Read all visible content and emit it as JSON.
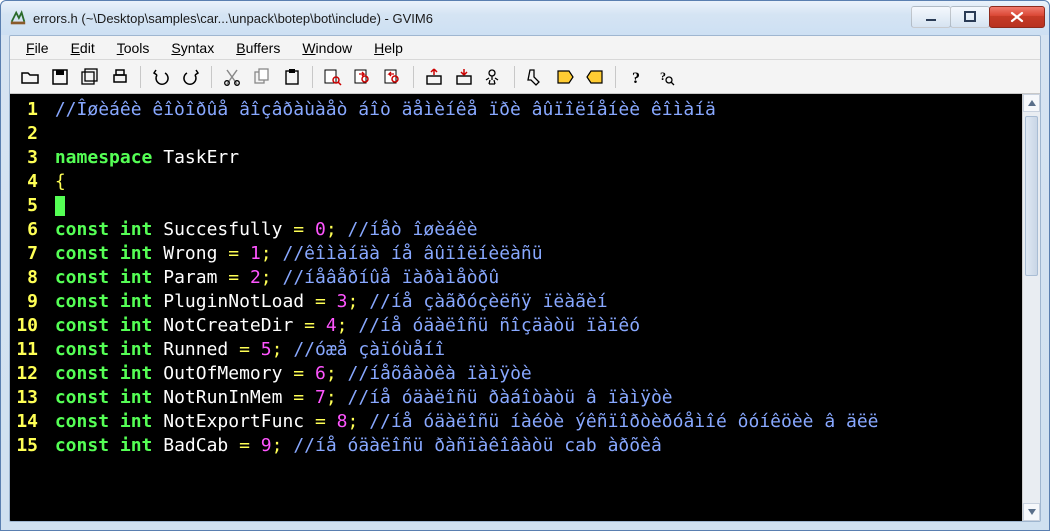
{
  "title": "errors.h (~\\Desktop\\samples\\car...\\unpack\\botep\\bot\\include) - GVIM6",
  "menus": {
    "file": {
      "accel": "F",
      "rest": "ile"
    },
    "edit": {
      "accel": "E",
      "rest": "dit"
    },
    "tools": {
      "accel": "T",
      "rest": "ools"
    },
    "syntax": {
      "accel": "S",
      "rest": "yntax"
    },
    "buffers": {
      "accel": "B",
      "rest": "uffers"
    },
    "window": {
      "accel": "W",
      "rest": "indow"
    },
    "help": {
      "accel": "H",
      "rest": "elp"
    }
  },
  "code_lines": [
    {
      "n": "1",
      "tokens": [
        {
          "c": "tok-comment",
          "t": "//Îøèáêè êîòîðûå âîçâðàùàåò áîò äåìèíêå ïðè âûïîëíåíèè êîìàíä"
        }
      ]
    },
    {
      "n": "2",
      "tokens": [
        {
          "c": "tok-plain",
          "t": ""
        }
      ]
    },
    {
      "n": "3",
      "tokens": [
        {
          "c": "tok-ns",
          "t": "namespace"
        },
        {
          "c": "tok-plain",
          "t": " "
        },
        {
          "c": "tok-ident",
          "t": "TaskErr"
        }
      ]
    },
    {
      "n": "4",
      "tokens": [
        {
          "c": "tok-punct",
          "t": "{"
        }
      ]
    },
    {
      "n": "5",
      "tokens": [
        {
          "cursor": true
        }
      ]
    },
    {
      "n": "6",
      "tokens": [
        {
          "c": "tok-const",
          "t": "const"
        },
        {
          "c": "tok-plain",
          "t": " "
        },
        {
          "c": "tok-type",
          "t": "int"
        },
        {
          "c": "tok-plain",
          "t": " "
        },
        {
          "c": "tok-ident",
          "t": "Succesfully"
        },
        {
          "c": "tok-plain",
          "t": " "
        },
        {
          "c": "tok-punct",
          "t": "="
        },
        {
          "c": "tok-plain",
          "t": " "
        },
        {
          "c": "tok-num",
          "t": "0"
        },
        {
          "c": "tok-punct",
          "t": ";"
        },
        {
          "c": "tok-plain",
          "t": " "
        },
        {
          "c": "tok-comment",
          "t": "//íåò îøèáêè"
        }
      ]
    },
    {
      "n": "7",
      "tokens": [
        {
          "c": "tok-const",
          "t": "const"
        },
        {
          "c": "tok-plain",
          "t": " "
        },
        {
          "c": "tok-type",
          "t": "int"
        },
        {
          "c": "tok-plain",
          "t": " "
        },
        {
          "c": "tok-ident",
          "t": "Wrong"
        },
        {
          "c": "tok-plain",
          "t": " "
        },
        {
          "c": "tok-punct",
          "t": "="
        },
        {
          "c": "tok-plain",
          "t": " "
        },
        {
          "c": "tok-num",
          "t": "1"
        },
        {
          "c": "tok-punct",
          "t": ";"
        },
        {
          "c": "tok-plain",
          "t": " "
        },
        {
          "c": "tok-comment",
          "t": "//êîìàíäà íå âûïîëíèëàñü"
        }
      ]
    },
    {
      "n": "8",
      "tokens": [
        {
          "c": "tok-const",
          "t": "const"
        },
        {
          "c": "tok-plain",
          "t": " "
        },
        {
          "c": "tok-type",
          "t": "int"
        },
        {
          "c": "tok-plain",
          "t": " "
        },
        {
          "c": "tok-ident",
          "t": "Param"
        },
        {
          "c": "tok-plain",
          "t": " "
        },
        {
          "c": "tok-punct",
          "t": "="
        },
        {
          "c": "tok-plain",
          "t": " "
        },
        {
          "c": "tok-num",
          "t": "2"
        },
        {
          "c": "tok-punct",
          "t": ";"
        },
        {
          "c": "tok-plain",
          "t": " "
        },
        {
          "c": "tok-comment",
          "t": "//íåâåðíûå ïàðàìåòðû"
        }
      ]
    },
    {
      "n": "9",
      "tokens": [
        {
          "c": "tok-const",
          "t": "const"
        },
        {
          "c": "tok-plain",
          "t": " "
        },
        {
          "c": "tok-type",
          "t": "int"
        },
        {
          "c": "tok-plain",
          "t": " "
        },
        {
          "c": "tok-ident",
          "t": "PluginNotLoad"
        },
        {
          "c": "tok-plain",
          "t": " "
        },
        {
          "c": "tok-punct",
          "t": "="
        },
        {
          "c": "tok-plain",
          "t": " "
        },
        {
          "c": "tok-num",
          "t": "3"
        },
        {
          "c": "tok-punct",
          "t": ";"
        },
        {
          "c": "tok-plain",
          "t": " "
        },
        {
          "c": "tok-comment",
          "t": "//íå çàãðóçèëñÿ ïëàãèí"
        }
      ]
    },
    {
      "n": "10",
      "tokens": [
        {
          "c": "tok-const",
          "t": "const"
        },
        {
          "c": "tok-plain",
          "t": " "
        },
        {
          "c": "tok-type",
          "t": "int"
        },
        {
          "c": "tok-plain",
          "t": " "
        },
        {
          "c": "tok-ident",
          "t": "NotCreateDir"
        },
        {
          "c": "tok-plain",
          "t": " "
        },
        {
          "c": "tok-punct",
          "t": "="
        },
        {
          "c": "tok-plain",
          "t": " "
        },
        {
          "c": "tok-num",
          "t": "4"
        },
        {
          "c": "tok-punct",
          "t": ";"
        },
        {
          "c": "tok-plain",
          "t": " "
        },
        {
          "c": "tok-comment",
          "t": "//íå óäàëîñü ñîçäàòü ïàïêó"
        }
      ]
    },
    {
      "n": "11",
      "tokens": [
        {
          "c": "tok-const",
          "t": "const"
        },
        {
          "c": "tok-plain",
          "t": " "
        },
        {
          "c": "tok-type",
          "t": "int"
        },
        {
          "c": "tok-plain",
          "t": " "
        },
        {
          "c": "tok-ident",
          "t": "Runned"
        },
        {
          "c": "tok-plain",
          "t": " "
        },
        {
          "c": "tok-punct",
          "t": "="
        },
        {
          "c": "tok-plain",
          "t": " "
        },
        {
          "c": "tok-num",
          "t": "5"
        },
        {
          "c": "tok-punct",
          "t": ";"
        },
        {
          "c": "tok-plain",
          "t": " "
        },
        {
          "c": "tok-comment",
          "t": "//óæå çàïóùåíî"
        }
      ]
    },
    {
      "n": "12",
      "tokens": [
        {
          "c": "tok-const",
          "t": "const"
        },
        {
          "c": "tok-plain",
          "t": " "
        },
        {
          "c": "tok-type",
          "t": "int"
        },
        {
          "c": "tok-plain",
          "t": " "
        },
        {
          "c": "tok-ident",
          "t": "OutOfMemory"
        },
        {
          "c": "tok-plain",
          "t": " "
        },
        {
          "c": "tok-punct",
          "t": "="
        },
        {
          "c": "tok-plain",
          "t": " "
        },
        {
          "c": "tok-num",
          "t": "6"
        },
        {
          "c": "tok-punct",
          "t": ";"
        },
        {
          "c": "tok-plain",
          "t": " "
        },
        {
          "c": "tok-comment",
          "t": "//íåõâàòêà ïàìÿòè"
        }
      ]
    },
    {
      "n": "13",
      "tokens": [
        {
          "c": "tok-const",
          "t": "const"
        },
        {
          "c": "tok-plain",
          "t": " "
        },
        {
          "c": "tok-type",
          "t": "int"
        },
        {
          "c": "tok-plain",
          "t": " "
        },
        {
          "c": "tok-ident",
          "t": "NotRunInMem"
        },
        {
          "c": "tok-plain",
          "t": " "
        },
        {
          "c": "tok-punct",
          "t": "="
        },
        {
          "c": "tok-plain",
          "t": " "
        },
        {
          "c": "tok-num",
          "t": "7"
        },
        {
          "c": "tok-punct",
          "t": ";"
        },
        {
          "c": "tok-plain",
          "t": " "
        },
        {
          "c": "tok-comment",
          "t": "//íå óäàëîñü ðàáîòàòü â ïàìÿòè"
        }
      ]
    },
    {
      "n": "14",
      "tokens": [
        {
          "c": "tok-const",
          "t": "const"
        },
        {
          "c": "tok-plain",
          "t": " "
        },
        {
          "c": "tok-type",
          "t": "int"
        },
        {
          "c": "tok-plain",
          "t": " "
        },
        {
          "c": "tok-ident",
          "t": "NotExportFunc"
        },
        {
          "c": "tok-plain",
          "t": " "
        },
        {
          "c": "tok-punct",
          "t": "="
        },
        {
          "c": "tok-plain",
          "t": " "
        },
        {
          "c": "tok-num",
          "t": "8"
        },
        {
          "c": "tok-punct",
          "t": ";"
        },
        {
          "c": "tok-plain",
          "t": " "
        },
        {
          "c": "tok-comment",
          "t": "//íå óäàëîñü íàéòè ýêñïîðòèðóåìîé ôóíêöèè â äëë"
        }
      ]
    },
    {
      "n": "15",
      "tokens": [
        {
          "c": "tok-const",
          "t": "const"
        },
        {
          "c": "tok-plain",
          "t": " "
        },
        {
          "c": "tok-type",
          "t": "int"
        },
        {
          "c": "tok-plain",
          "t": " "
        },
        {
          "c": "tok-ident",
          "t": "BadCab"
        },
        {
          "c": "tok-plain",
          "t": " "
        },
        {
          "c": "tok-punct",
          "t": "="
        },
        {
          "c": "tok-plain",
          "t": " "
        },
        {
          "c": "tok-num",
          "t": "9"
        },
        {
          "c": "tok-punct",
          "t": ";"
        },
        {
          "c": "tok-plain",
          "t": " "
        },
        {
          "c": "tok-comment",
          "t": "//íå óäàëîñü ðàñïàêîâàòü cab àðõèâ"
        }
      ]
    }
  ],
  "toolbar_icons": [
    "open-icon",
    "save-icon",
    "save-all-icon",
    "print-icon",
    "sep",
    "undo-icon",
    "redo-icon",
    "sep",
    "cut-icon",
    "copy-icon",
    "paste-icon",
    "sep",
    "find-icon",
    "find-next-icon",
    "find-prev-icon",
    "sep",
    "load-session-icon",
    "save-session-icon",
    "run-script-icon",
    "sep",
    "make-icon",
    "tag-jump-icon",
    "tag-back-icon",
    "sep",
    "help-icon",
    "find-help-icon"
  ]
}
